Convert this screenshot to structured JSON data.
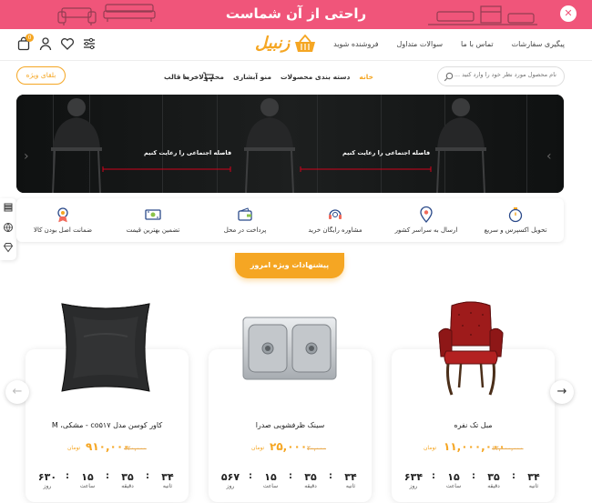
{
  "banner": {
    "title": "راحتی از آن شماست",
    "close_label": "✕"
  },
  "header": {
    "nav": [
      "پیگیری سفارشات",
      "تماس با ما",
      "سوالات متداول",
      "فروشنده شوید"
    ],
    "logo_text": "زنبیل",
    "cart_count": "0"
  },
  "search": {
    "placeholder": "نام محصول مورد نظر خود را وارد کنید ... بگرد"
  },
  "main_nav": {
    "items": [
      "خانه",
      "دسته بندی محصولات",
      "منو آبشاری",
      "محصولات ما"
    ],
    "buy_theme": "خرید قالب",
    "special": "بلقای ویژه"
  },
  "hero": {
    "caption": "فاصله اجتماعی را رعایت کنیم"
  },
  "features": [
    {
      "label": "تحویل اکسپرس و سریع",
      "icon": "stopwatch-icon"
    },
    {
      "label": "ارسال به سراسر کشور",
      "icon": "map-pin-icon"
    },
    {
      "label": "مشاوره رایگان خرید",
      "icon": "headset-icon"
    },
    {
      "label": "پرداخت در محل",
      "icon": "wallet-icon"
    },
    {
      "label": "تضمین بهترین قیمت",
      "icon": "money-icon"
    },
    {
      "label": "ضمانت اصل بودن کالا",
      "icon": "award-icon"
    }
  ],
  "offers_title": "پیشنهادات ویژه امروز",
  "products": [
    {
      "name": "مبل تک نفره",
      "old_price": "۱۳,۰۰۰,۰۰۰",
      "price": "۱۱,۰۰۰,۰۰۰",
      "currency": "تومان",
      "timer": {
        "days": "۶۳۴",
        "hours": "۱۵",
        "minutes": "۳۵",
        "seconds": "۳۴"
      }
    },
    {
      "name": "سینک ظرفشویی صدرا",
      "old_price": "۳۰,۰۰۰",
      "price": "۲۵,۰۰۰",
      "currency": "تومان",
      "timer": {
        "days": "۵۶۷",
        "hours": "۱۵",
        "minutes": "۳۵",
        "seconds": "۳۴"
      }
    },
    {
      "name": "کاور کوسن مدل co۵۱۷ - مشکی، M",
      "old_price": "۱۲۰,۰۰۰",
      "price": "۹۱۰,۰۰۰",
      "currency": "تومان",
      "timer": {
        "days": "۶۳۰",
        "hours": "۱۵",
        "minutes": "۳۵",
        "seconds": "۳۴"
      }
    }
  ],
  "timer_labels": {
    "seconds": "ثانیه",
    "minutes": "دقیقه",
    "hours": "ساعت",
    "days": "روز"
  },
  "colors": {
    "accent": "#f5a623",
    "banner": "#f0557a",
    "hero_bg": "#141515",
    "divider": "#d0021b"
  }
}
